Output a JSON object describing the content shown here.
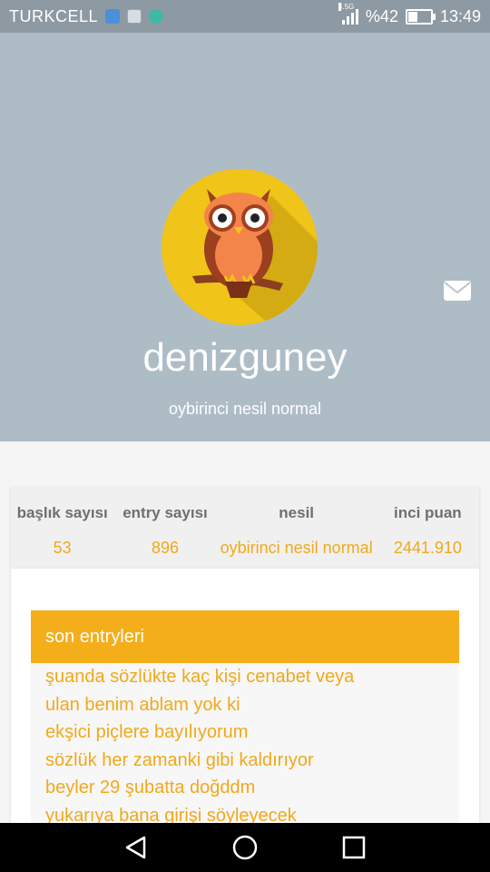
{
  "status_bar": {
    "carrier": "TURKCELL",
    "network": "4.5G",
    "battery": "%42",
    "time": "13:49"
  },
  "profile": {
    "username": "denizguney",
    "rank": "oybirinci nesil normal"
  },
  "stats": [
    {
      "label": "başlık sayısı",
      "value": "53"
    },
    {
      "label": "entry sayısı",
      "value": "896"
    },
    {
      "label": "nesil",
      "value": "oybirinci nesil normal"
    },
    {
      "label": "inci puan",
      "value": "2441.910"
    }
  ],
  "recent": {
    "title": "son entryleri",
    "entries": [
      "şuanda sözlükte kaç kişi cenabet veya",
      "ulan benim ablam yok ki",
      "ekşici piçlere bayılıyorum",
      "sözlük her zamanki gibi kaldırıyor",
      "beyler 29 şubatta doğddm",
      "yukarıya bana girişi söyleyecek"
    ]
  },
  "colors": {
    "header_bg": "#aebcc5",
    "accent": "#f3ae1a",
    "avatar_bg": "#f0c418"
  },
  "icons": [
    "health-icon",
    "gallery-icon",
    "info-icon",
    "signal-icon",
    "battery-icon",
    "mail-icon",
    "owl-avatar",
    "back-icon",
    "home-icon",
    "recents-icon"
  ]
}
